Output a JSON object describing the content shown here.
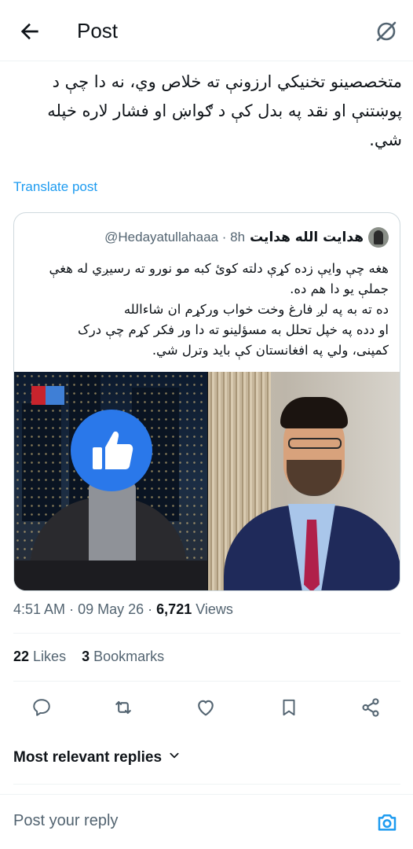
{
  "header": {
    "title": "Post"
  },
  "post": {
    "text": "متخصصینو تخنیکي ارزونې ته خلاص وي، نه دا چې د پوښتنې او نقد په بدل کې د ګواښ او فشار لاره خپله شي.",
    "translate_label": "Translate post"
  },
  "quote": {
    "author_name": "هدایت الله هدایت",
    "handle": "@Hedayatullahaaa",
    "separator": "·",
    "time": "8h",
    "text_lines": [
      "هغه چې وایې زده کړې دلته کوئ کبه مو نورو ته رسیږي له هغې",
      "جملې یو دا هم ده.",
      "ده ته به په لږ فارغ وخت خواب ورکړم ان شاءالله",
      "او دده په خپل تحلل به مسؤلینو ته دا ور فکر کړم چې درک",
      "کمپنی، ولي په افغانستان کې باید وترل شي."
    ]
  },
  "meta": {
    "time": "4:51 AM",
    "sep1": "·",
    "date": "09 May 26",
    "sep2": "·",
    "views_count": "6,721",
    "views_label": "Views"
  },
  "stats": {
    "likes_count": "22",
    "likes_label": "Likes",
    "bookmarks_count": "3",
    "bookmarks_label": "Bookmarks"
  },
  "icons": {
    "back": "arrow-left-icon",
    "grok": "grok-slash-icon",
    "reply": "reply-icon",
    "repost": "repost-icon",
    "like": "heart-icon",
    "bookmark": "bookmark-icon",
    "share": "share-icon",
    "camera": "camera-icon",
    "chevron": "chevron-down-icon"
  },
  "replies": {
    "sort_label": "Most relevant replies"
  },
  "reply_bar": {
    "placeholder": "Post your reply"
  },
  "colors": {
    "accent": "#1d9bf0",
    "text": "#0f1419",
    "muted": "#536471",
    "border": "#cfd9de"
  }
}
